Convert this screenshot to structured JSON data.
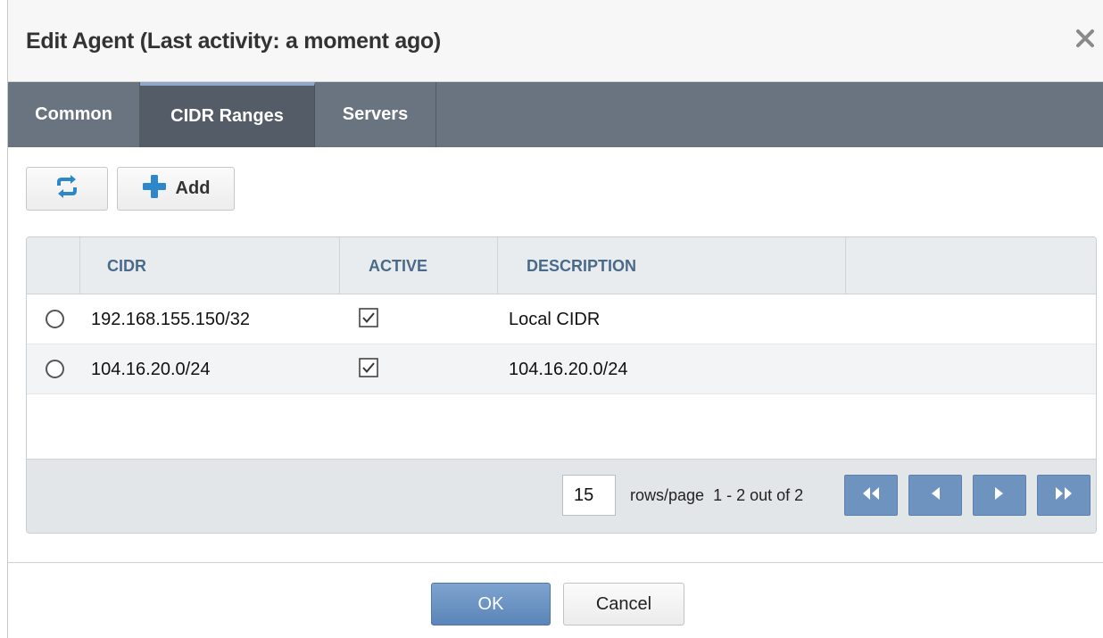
{
  "dialog": {
    "title": "Edit Agent (Last activity: a moment ago)",
    "close_icon": "close-icon"
  },
  "tabs": [
    {
      "label": "Common",
      "active": false
    },
    {
      "label": "CIDR Ranges",
      "active": true
    },
    {
      "label": "Servers",
      "active": false
    }
  ],
  "toolbar": {
    "refresh_icon": "refresh-icon",
    "add_icon": "plus-icon",
    "add_label": "Add"
  },
  "grid": {
    "columns": [
      "CIDR",
      "ACTIVE",
      "DESCRIPTION"
    ],
    "rows": [
      {
        "cidr": "192.168.155.150/32",
        "active": true,
        "description": "Local CIDR"
      },
      {
        "cidr": "104.16.20.0/24",
        "active": true,
        "description": "104.16.20.0/24"
      }
    ],
    "pager": {
      "rows_per_page": "15",
      "rows_label": "rows/page",
      "range_text": "1 - 2 out of 2",
      "icons": [
        "first-page-icon",
        "prev-page-icon",
        "next-page-icon",
        "last-page-icon"
      ]
    }
  },
  "footer": {
    "ok_label": "OK",
    "cancel_label": "Cancel"
  },
  "colors": {
    "tabbar": "#6a7380",
    "active_tab": "#545c67",
    "accent_blue": "#6f93bf",
    "header_text": "#4a6a8a"
  }
}
